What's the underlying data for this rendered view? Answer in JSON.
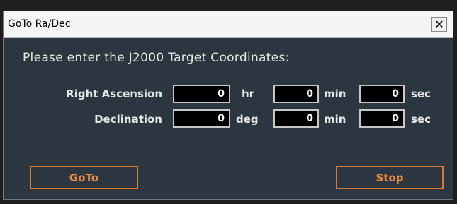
{
  "window": {
    "title": "GoTo Ra/Dec",
    "close_label": "x"
  },
  "prompt": "Please enter the J2000 Target Coordinates:",
  "right_ascension": {
    "label": "Right Ascension",
    "hours": "0",
    "hours_unit": "hr",
    "minutes": "0",
    "minutes_unit": "min",
    "seconds": "0",
    "seconds_unit": "sec"
  },
  "declination": {
    "label": "Declination",
    "degrees": "0",
    "degrees_unit": "deg",
    "minutes": "0",
    "minutes_unit": "min",
    "seconds": "0",
    "seconds_unit": "sec"
  },
  "buttons": {
    "goto_label": "GoTo",
    "stop_label": "Stop"
  },
  "colors": {
    "background": "#2b3641",
    "accent": "#d8792f",
    "text": "#e6e6e6"
  }
}
